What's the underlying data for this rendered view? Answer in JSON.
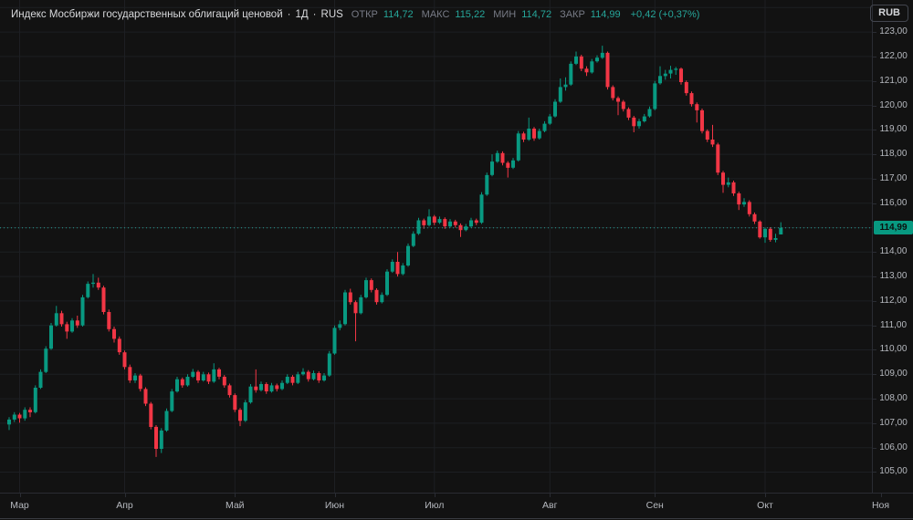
{
  "legend": {
    "title": "Индекс Мосбиржи государственных облигаций ценовой",
    "sep1": "·",
    "timeframe": "1Д",
    "sep2": "·",
    "exchange": "RUS",
    "ohlc": [
      {
        "label": "ОТКР",
        "value": "114,72"
      },
      {
        "label": "МАКС",
        "value": "115,22"
      },
      {
        "label": "МИН",
        "value": "114,72"
      },
      {
        "label": "ЗАКР",
        "value": "114,99"
      }
    ],
    "change": "+0,42 (+0,37%)"
  },
  "toolbar": {
    "currency": "RUB"
  },
  "price_axis": {
    "last_label": "114,99"
  },
  "colors": {
    "up": "#089981",
    "down": "#f23645",
    "accent_value_text": "#26a69a",
    "last_label_bg": "#089981",
    "background": "#121212",
    "grid": "#1d1f23",
    "axis_text": "#b6b9bf"
  },
  "chart_data": {
    "type": "candlestick",
    "title": "Индекс Мосбиржи государственных облигаций ценовой",
    "timeframe": "1Д",
    "currency": "RUB",
    "last_price": 114.99,
    "open": 114.72,
    "high": 115.22,
    "low": 114.72,
    "close": 114.99,
    "change_abs": 0.42,
    "change_pct": 0.37,
    "ylim": [
      104.16,
      124.31
    ],
    "grid": true,
    "y_ticks": [
      "123,00",
      "122,00",
      "121,00",
      "120,00",
      "119,00",
      "118,00",
      "117,00",
      "116,00",
      "114,00",
      "113,00",
      "112,00",
      "111,00",
      "110,00",
      "109,00",
      "108,00",
      "107,00",
      "106,00",
      "105,00"
    ],
    "months": [
      {
        "label": "Мар",
        "index": 2
      },
      {
        "label": "Апр",
        "index": 22
      },
      {
        "label": "Май",
        "index": 43
      },
      {
        "label": "Июн",
        "index": 62
      },
      {
        "label": "Июл",
        "index": 81
      },
      {
        "label": "Авг",
        "index": 103
      },
      {
        "label": "Сен",
        "index": 123
      },
      {
        "label": "Окт",
        "index": 144
      },
      {
        "label": "Ноя",
        "index": 166
      }
    ],
    "candles": [
      [
        106.95,
        107.25,
        106.72,
        107.15
      ],
      [
        107.15,
        107.45,
        107.05,
        107.35
      ],
      [
        107.35,
        107.42,
        107.02,
        107.2
      ],
      [
        107.2,
        107.65,
        107.1,
        107.55
      ],
      [
        107.55,
        107.65,
        107.25,
        107.45
      ],
      [
        107.45,
        108.55,
        107.4,
        108.45
      ],
      [
        108.45,
        109.2,
        108.4,
        109.1
      ],
      [
        109.1,
        110.15,
        109.05,
        110.05
      ],
      [
        110.05,
        111.1,
        110.0,
        111.0
      ],
      [
        111.0,
        111.8,
        110.95,
        111.5
      ],
      [
        111.5,
        111.6,
        110.95,
        111.05
      ],
      [
        111.05,
        111.15,
        110.45,
        110.75
      ],
      [
        110.75,
        111.3,
        110.7,
        111.2
      ],
      [
        111.2,
        111.4,
        110.9,
        111.0
      ],
      [
        111.0,
        112.25,
        110.95,
        112.15
      ],
      [
        112.15,
        112.8,
        112.1,
        112.7
      ],
      [
        112.7,
        113.1,
        112.55,
        112.75
      ],
      [
        112.75,
        112.95,
        112.45,
        112.55
      ],
      [
        112.55,
        112.62,
        111.45,
        111.55
      ],
      [
        111.55,
        111.65,
        110.75,
        110.85
      ],
      [
        110.85,
        110.95,
        110.3,
        110.45
      ],
      [
        110.45,
        110.55,
        109.8,
        109.9
      ],
      [
        109.9,
        109.97,
        109.2,
        109.3
      ],
      [
        109.3,
        109.4,
        108.65,
        108.75
      ],
      [
        108.75,
        109.05,
        108.65,
        108.95
      ],
      [
        108.95,
        109.02,
        108.3,
        108.4
      ],
      [
        108.4,
        108.47,
        107.7,
        107.8
      ],
      [
        107.8,
        107.87,
        106.75,
        106.85
      ],
      [
        106.85,
        106.92,
        105.62,
        105.95
      ],
      [
        105.95,
        106.8,
        105.78,
        106.7
      ],
      [
        106.7,
        107.6,
        106.65,
        107.5
      ],
      [
        107.5,
        108.4,
        107.45,
        108.3
      ],
      [
        108.3,
        108.9,
        108.25,
        108.8
      ],
      [
        108.8,
        108.87,
        108.45,
        108.55
      ],
      [
        108.55,
        109.0,
        108.5,
        108.9
      ],
      [
        108.9,
        109.22,
        108.85,
        109.1
      ],
      [
        109.1,
        109.17,
        108.65,
        108.75
      ],
      [
        108.75,
        109.1,
        108.7,
        109.0
      ],
      [
        109.0,
        109.07,
        108.6,
        108.7
      ],
      [
        108.7,
        109.45,
        108.65,
        109.2
      ],
      [
        109.2,
        109.27,
        108.8,
        108.9
      ],
      [
        108.9,
        108.97,
        108.45,
        108.55
      ],
      [
        108.55,
        108.62,
        108.05,
        108.15
      ],
      [
        108.15,
        108.22,
        107.45,
        107.55
      ],
      [
        107.55,
        107.62,
        106.88,
        107.1
      ],
      [
        107.1,
        107.95,
        107.05,
        107.85
      ],
      [
        107.85,
        108.6,
        107.8,
        108.5
      ],
      [
        108.5,
        109.2,
        108.25,
        108.35
      ],
      [
        108.35,
        108.7,
        108.3,
        108.6
      ],
      [
        108.6,
        108.67,
        108.2,
        108.3
      ],
      [
        108.3,
        108.65,
        108.25,
        108.55
      ],
      [
        108.55,
        108.62,
        108.3,
        108.4
      ],
      [
        108.4,
        108.75,
        108.35,
        108.65
      ],
      [
        108.65,
        109.0,
        108.6,
        108.9
      ],
      [
        108.9,
        108.97,
        108.55,
        108.65
      ],
      [
        108.65,
        109.1,
        108.6,
        109.0
      ],
      [
        109.0,
        109.25,
        108.95,
        109.1
      ],
      [
        109.1,
        109.17,
        108.7,
        108.8
      ],
      [
        108.8,
        109.15,
        108.75,
        109.05
      ],
      [
        109.05,
        109.12,
        108.65,
        108.75
      ],
      [
        108.75,
        109.05,
        108.7,
        108.95
      ],
      [
        108.95,
        109.95,
        108.9,
        109.85
      ],
      [
        109.85,
        111.0,
        109.8,
        110.9
      ],
      [
        110.9,
        111.2,
        110.8,
        111.05
      ],
      [
        111.05,
        112.45,
        111.0,
        112.35
      ],
      [
        112.35,
        112.5,
        111.85,
        111.95
      ],
      [
        111.95,
        112.02,
        110.35,
        111.5
      ],
      [
        111.5,
        112.25,
        111.45,
        112.15
      ],
      [
        112.15,
        112.95,
        112.1,
        112.85
      ],
      [
        112.85,
        112.92,
        112.35,
        112.45
      ],
      [
        112.45,
        112.52,
        111.85,
        111.95
      ],
      [
        111.95,
        112.35,
        111.9,
        112.25
      ],
      [
        112.25,
        113.3,
        112.2,
        113.2
      ],
      [
        113.2,
        113.7,
        113.15,
        113.6
      ],
      [
        113.6,
        114.0,
        113.0,
        113.1
      ],
      [
        113.1,
        113.55,
        113.05,
        113.45
      ],
      [
        113.45,
        114.35,
        113.4,
        114.25
      ],
      [
        114.25,
        114.85,
        114.2,
        114.75
      ],
      [
        114.75,
        115.4,
        114.7,
        115.3
      ],
      [
        115.3,
        115.37,
        114.95,
        115.1
      ],
      [
        115.1,
        115.75,
        115.05,
        115.45
      ],
      [
        115.45,
        115.52,
        115.1,
        115.2
      ],
      [
        115.2,
        115.45,
        115.15,
        115.35
      ],
      [
        115.35,
        115.42,
        114.95,
        115.05
      ],
      [
        115.05,
        115.35,
        115.0,
        115.25
      ],
      [
        115.25,
        115.32,
        115.0,
        115.1
      ],
      [
        115.1,
        115.17,
        114.62,
        114.9
      ],
      [
        114.9,
        115.15,
        114.85,
        115.05
      ],
      [
        115.05,
        115.4,
        115.0,
        115.3
      ],
      [
        115.3,
        115.37,
        115.1,
        115.2
      ],
      [
        115.2,
        116.45,
        115.15,
        116.35
      ],
      [
        116.35,
        117.25,
        116.3,
        117.15
      ],
      [
        117.15,
        118.0,
        117.1,
        117.7
      ],
      [
        117.7,
        118.15,
        117.65,
        118.05
      ],
      [
        118.05,
        118.12,
        117.55,
        117.65
      ],
      [
        117.65,
        117.72,
        117.05,
        117.45
      ],
      [
        117.45,
        117.85,
        117.4,
        117.75
      ],
      [
        117.75,
        118.95,
        117.7,
        118.85
      ],
      [
        118.85,
        118.92,
        118.5,
        118.6
      ],
      [
        118.6,
        119.5,
        118.55,
        119.05
      ],
      [
        119.05,
        119.12,
        118.55,
        118.65
      ],
      [
        118.65,
        119.05,
        118.6,
        118.95
      ],
      [
        118.95,
        119.35,
        118.9,
        119.25
      ],
      [
        119.25,
        119.65,
        119.2,
        119.55
      ],
      [
        119.55,
        120.25,
        119.5,
        120.15
      ],
      [
        120.15,
        121.1,
        120.1,
        120.75
      ],
      [
        120.75,
        121.15,
        120.6,
        120.85
      ],
      [
        120.85,
        121.8,
        120.8,
        121.7
      ],
      [
        121.7,
        122.2,
        121.65,
        122.0
      ],
      [
        122.0,
        122.07,
        121.4,
        121.5
      ],
      [
        121.5,
        121.6,
        121.2,
        121.35
      ],
      [
        121.35,
        121.9,
        121.3,
        121.8
      ],
      [
        121.8,
        122.05,
        121.75,
        121.95
      ],
      [
        121.95,
        122.44,
        121.9,
        122.15
      ],
      [
        122.15,
        122.2,
        120.65,
        120.75
      ],
      [
        120.75,
        120.82,
        120.2,
        120.3
      ],
      [
        120.3,
        120.37,
        119.6,
        120.15
      ],
      [
        120.15,
        120.22,
        119.75,
        119.85
      ],
      [
        119.85,
        119.92,
        119.4,
        119.5
      ],
      [
        119.5,
        119.57,
        118.9,
        119.15
      ],
      [
        119.15,
        119.45,
        119.05,
        119.35
      ],
      [
        119.35,
        119.65,
        119.3,
        119.55
      ],
      [
        119.55,
        119.95,
        119.5,
        119.85
      ],
      [
        119.85,
        121.0,
        119.8,
        120.9
      ],
      [
        120.9,
        121.6,
        120.85,
        121.2
      ],
      [
        121.2,
        121.45,
        121.05,
        121.3
      ],
      [
        121.3,
        121.62,
        121.1,
        121.45
      ],
      [
        121.45,
        121.57,
        121.25,
        121.5
      ],
      [
        121.5,
        121.55,
        120.85,
        120.95
      ],
      [
        120.95,
        121.02,
        120.4,
        120.5
      ],
      [
        120.5,
        120.57,
        119.95,
        120.05
      ],
      [
        120.05,
        120.12,
        119.3,
        119.8
      ],
      [
        119.8,
        119.87,
        118.85,
        118.95
      ],
      [
        118.95,
        119.02,
        118.5,
        118.6
      ],
      [
        118.6,
        119.2,
        118.3,
        118.4
      ],
      [
        118.4,
        118.47,
        117.15,
        117.25
      ],
      [
        117.25,
        117.32,
        116.42,
        116.75
      ],
      [
        116.75,
        117.05,
        116.65,
        116.85
      ],
      [
        116.85,
        116.92,
        116.3,
        116.4
      ],
      [
        116.4,
        116.47,
        115.72,
        115.95
      ],
      [
        115.95,
        116.2,
        115.85,
        116.05
      ],
      [
        116.05,
        116.12,
        115.45,
        115.55
      ],
      [
        115.55,
        115.62,
        115.15,
        115.25
      ],
      [
        115.25,
        115.3,
        114.55,
        114.6
      ],
      [
        114.6,
        115.0,
        114.38,
        114.95
      ],
      [
        114.95,
        115.02,
        114.42,
        114.5
      ],
      [
        114.5,
        114.75,
        114.4,
        114.57
      ],
      [
        114.72,
        115.22,
        114.72,
        114.99
      ]
    ]
  }
}
